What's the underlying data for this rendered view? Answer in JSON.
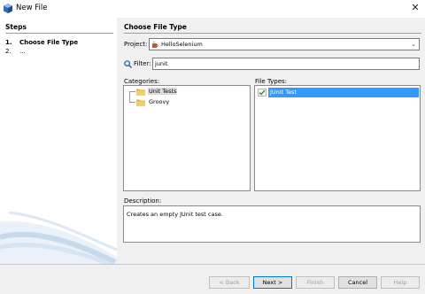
{
  "window": {
    "title": "New File",
    "close_glyph": "✕"
  },
  "steps": {
    "heading": "Steps",
    "items": [
      {
        "num": "1.",
        "label": "Choose File Type"
      },
      {
        "num": "2.",
        "label": "..."
      }
    ]
  },
  "main": {
    "heading": "Choose File Type",
    "project_label": "Project:",
    "project_value": "HelloSelenium",
    "filter_label": "Filter:",
    "filter_value": "junit",
    "categories_label": "Categories:",
    "categories": [
      {
        "label": "Unit Tests",
        "selected": true
      },
      {
        "label": "Groovy",
        "selected": false
      }
    ],
    "file_types_label": "File Types:",
    "file_types": [
      {
        "label": "JUnit Test",
        "selected": true
      }
    ],
    "description_label": "Description:",
    "description_text": "Creates an empty JUnit test case."
  },
  "buttons": {
    "back": "< Back",
    "next": "Next >",
    "finish": "Finish",
    "cancel": "Cancel",
    "help": "Help"
  },
  "colors": {
    "selection": "#3399ff",
    "panel_bg": "#f0f0f0",
    "default_button_border": "#0078d7"
  }
}
